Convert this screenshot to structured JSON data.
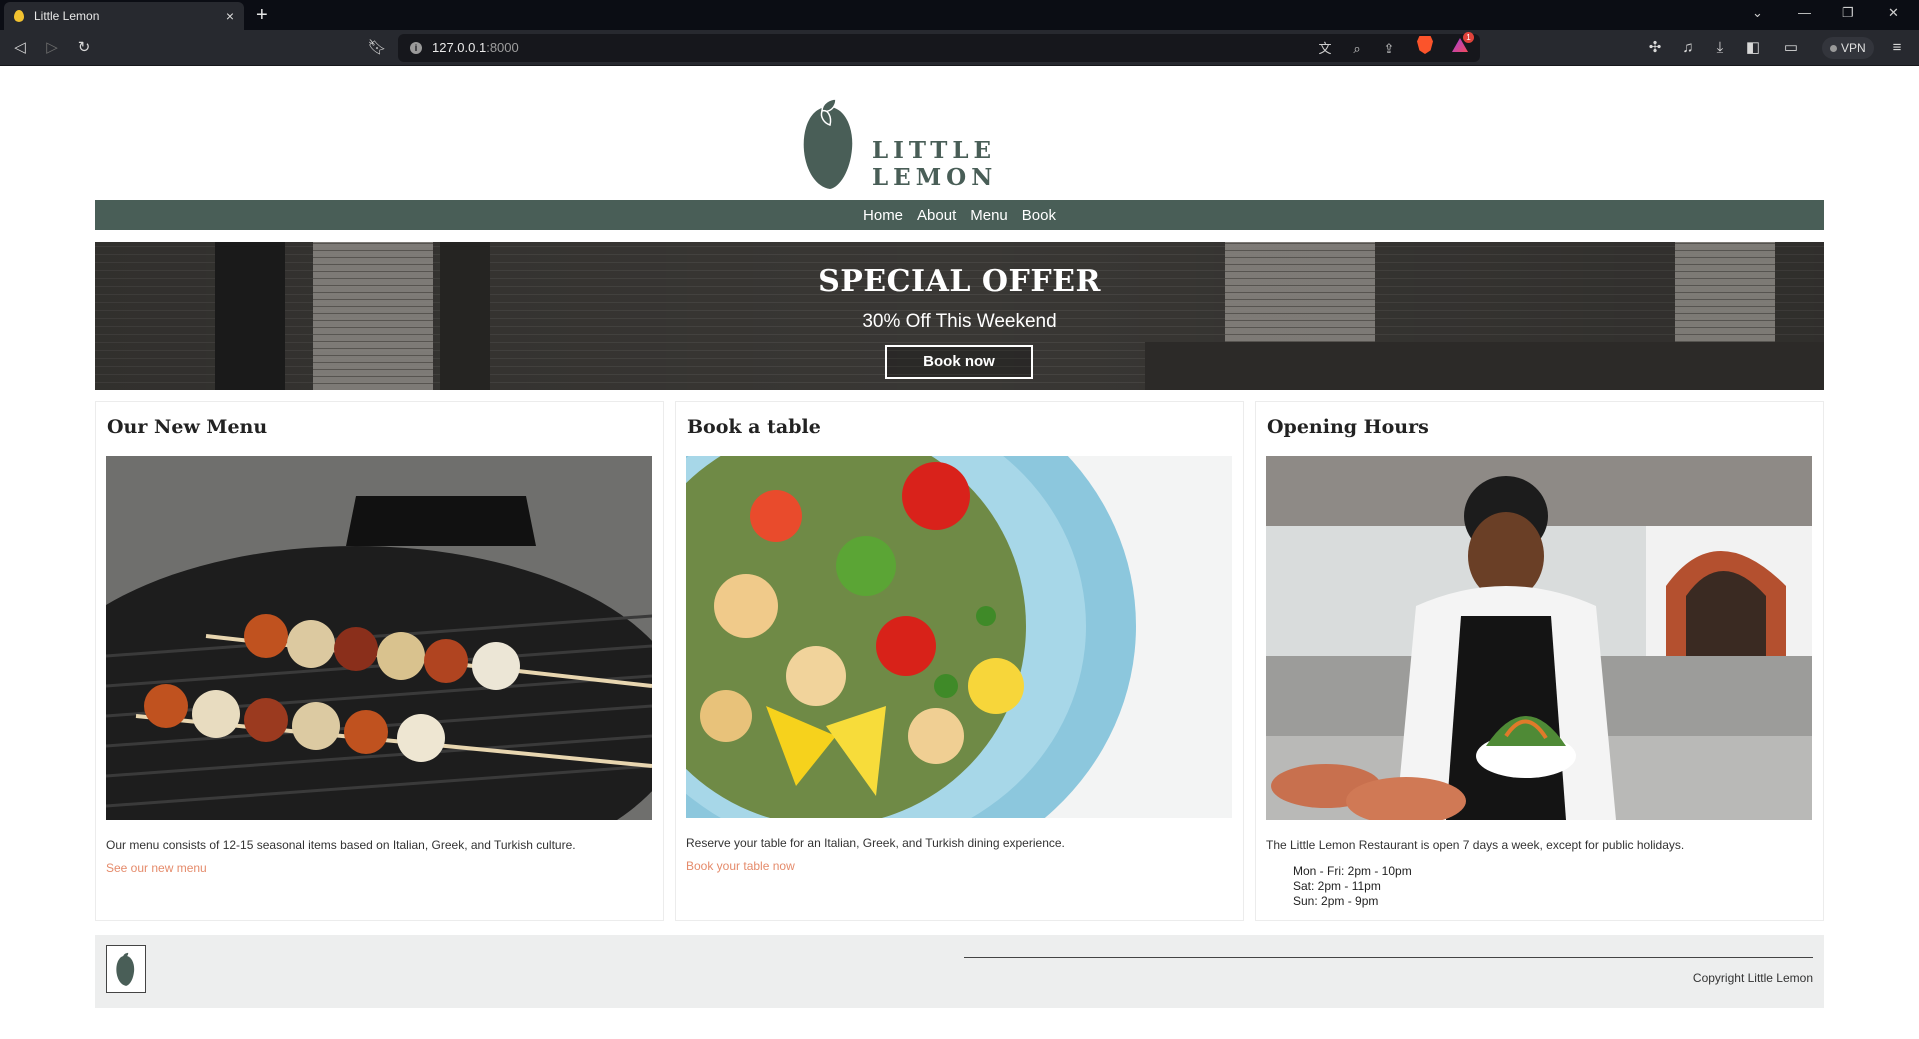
{
  "browser": {
    "tab_title": "Little Lemon",
    "tab_close": "×",
    "new_tab": "+",
    "url_host": "127.0.0.1",
    "url_port": ":8000",
    "vpn_label": "VPN",
    "rewards_count": "1"
  },
  "site": {
    "brand": "LITTLE LEMON",
    "brand_color": "#495e57",
    "accent_color": "#e58b6b",
    "nav": [
      "Home",
      "About",
      "Menu",
      "Book"
    ]
  },
  "hero": {
    "title": "SPECIAL OFFER",
    "subtitle": "30% Off This Weekend",
    "button": "Book now"
  },
  "cards": [
    {
      "title": "Our New Menu",
      "text": "Our menu consists of 12-15 seasonal items based on Italian, Greek, and Turkish culture.",
      "link": "See our new menu"
    },
    {
      "title": "Book a table",
      "text": "Reserve your table for an Italian, Greek, and Turkish dining experience.",
      "link": "Book your table now"
    },
    {
      "title": "Opening Hours",
      "text": "The Little Lemon Restaurant is open 7 days a week, except for public holidays.",
      "hours": [
        "Mon - Fri: 2pm - 10pm",
        "Sat: 2pm - 11pm",
        "Sun: 2pm - 9pm"
      ]
    }
  ],
  "footer": {
    "copyright": "Copyright Little Lemon"
  }
}
